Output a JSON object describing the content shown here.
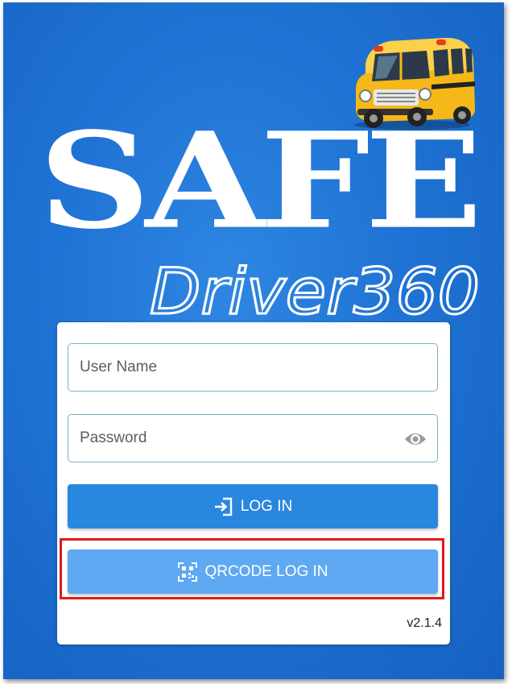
{
  "branding": {
    "title": "SAFE",
    "subtitle": "Driver360",
    "logo_icon": "school-bus-icon"
  },
  "login": {
    "username_placeholder": "User Name",
    "password_placeholder": "Password",
    "show_password_icon": "eye-icon",
    "login_button_label": "LOG IN",
    "login_button_icon": "login-arrow-icon",
    "qr_button_label": "QRCODE LOG IN",
    "qr_button_icon": "qr-code-icon",
    "version": "v2.1.4"
  },
  "colors": {
    "background": "#1f73d4",
    "login_button": "#2a87e0",
    "qr_button": "#5fa9f2",
    "highlight": "#e0181b",
    "field_border": "#7fb0c9"
  }
}
